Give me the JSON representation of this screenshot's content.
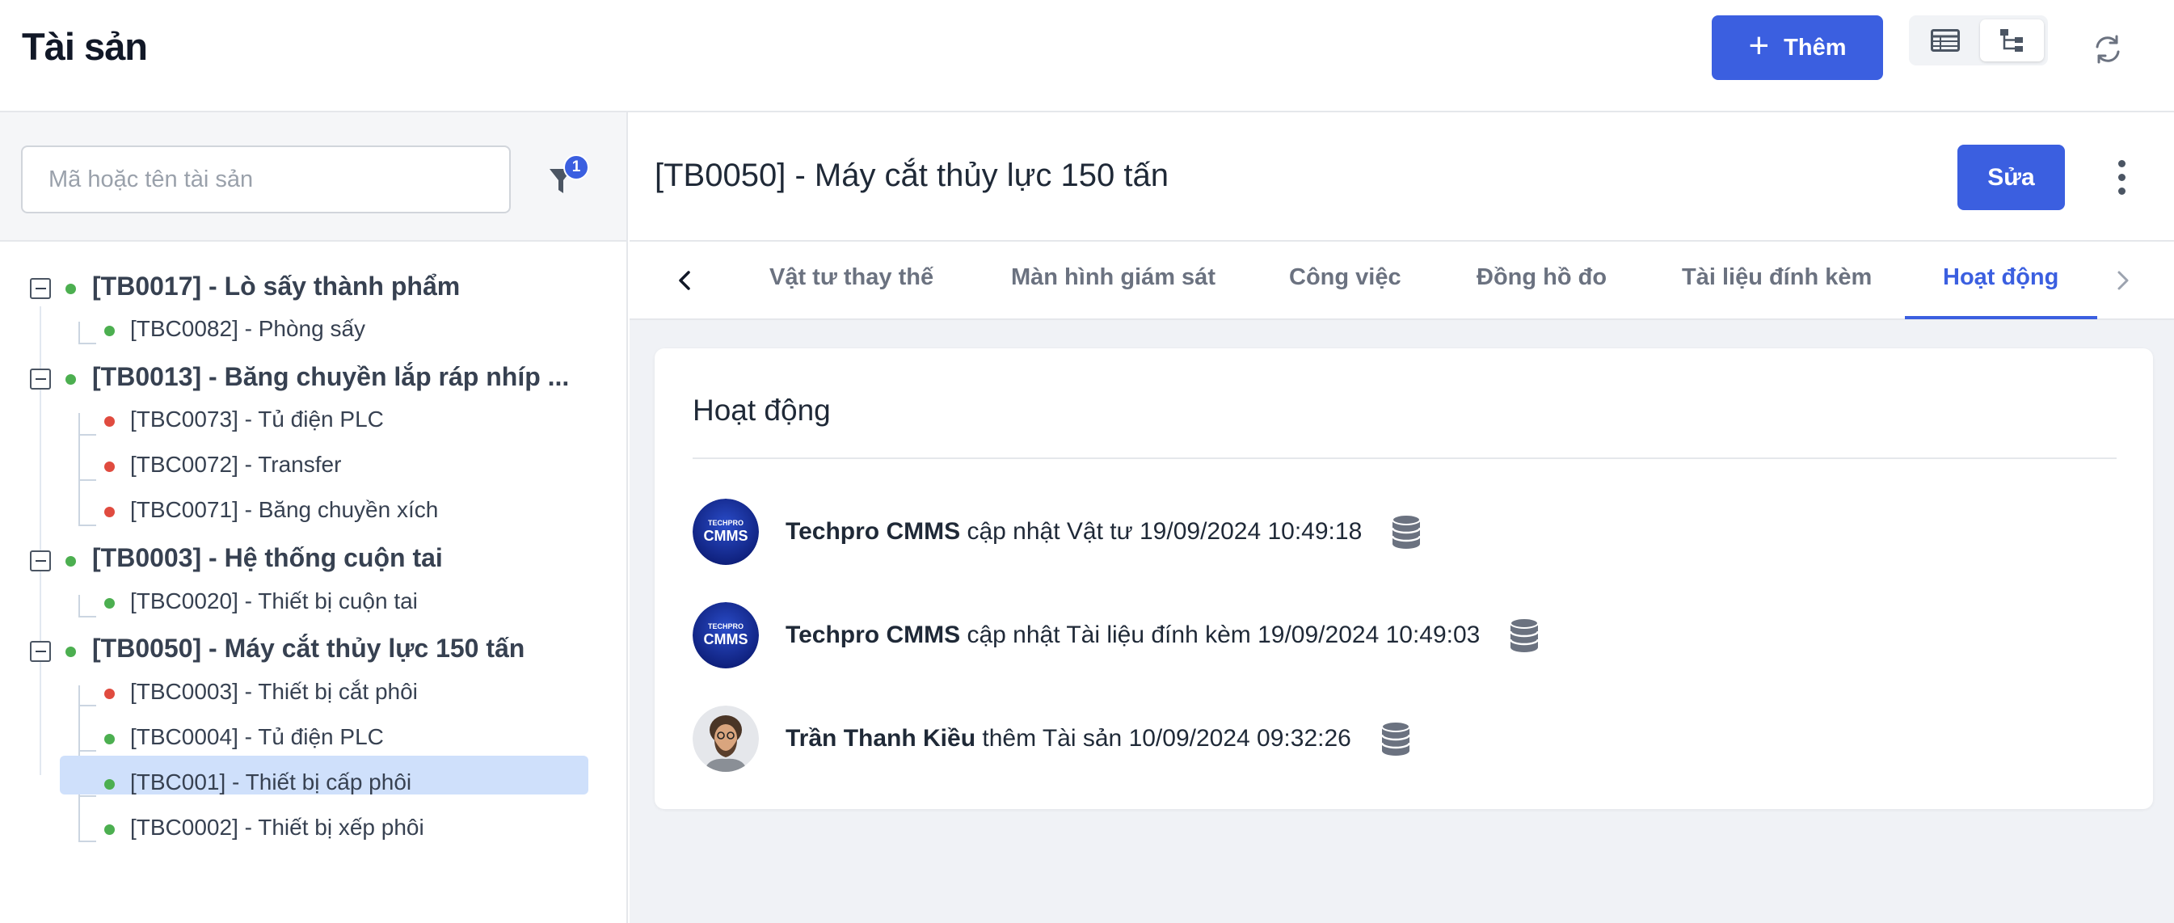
{
  "header": {
    "title": "Tài sản",
    "add_label": "Thêm"
  },
  "sidebar": {
    "search_placeholder": "Mã hoặc tên tài sản",
    "filter_count": "1",
    "tree": [
      {
        "label": "[TB0017] - Lò sấy thành phẩm",
        "status": "green",
        "children": [
          {
            "label": "[TBC0082] - Phòng sấy",
            "status": "green"
          }
        ]
      },
      {
        "label": "[TB0013] - Băng chuyền lắp ráp nhíp ...",
        "status": "green",
        "children": [
          {
            "label": "[TBC0073] - Tủ điện PLC",
            "status": "red"
          },
          {
            "label": "[TBC0072] - Transfer",
            "status": "red"
          },
          {
            "label": "[TBC0071] - Băng chuyền xích",
            "status": "red"
          }
        ]
      },
      {
        "label": "[TB0003] - Hệ thống cuộn tai",
        "status": "green",
        "children": [
          {
            "label": "[TBC0020] - Thiết bị cuộn tai",
            "status": "green"
          }
        ]
      },
      {
        "label": "[TB0050] - Máy cắt thủy lực 150 tấn",
        "status": "green",
        "selected": true,
        "children": [
          {
            "label": "[TBC0003] - Thiết bị cắt phôi",
            "status": "red"
          },
          {
            "label": "[TBC0004] - Tủ điện PLC",
            "status": "green"
          },
          {
            "label": "[TBC001] - Thiết bị cấp phôi",
            "status": "green"
          },
          {
            "label": "[TBC0002] - Thiết bị xếp phôi",
            "status": "green"
          }
        ]
      }
    ]
  },
  "detail": {
    "title": "[TB0050] - Máy cắt thủy lực 150 tấn",
    "edit_label": "Sửa",
    "tabs": [
      {
        "label": "Vật tư thay thế"
      },
      {
        "label": "Màn hình giám sát"
      },
      {
        "label": "Công việc"
      },
      {
        "label": "Đồng hồ đo"
      },
      {
        "label": "Tài liệu đính kèm"
      },
      {
        "label": "Hoạt động",
        "active": true
      }
    ],
    "activity": {
      "title": "Hoạt động",
      "items": [
        {
          "actor": "Techpro CMMS",
          "text": " cập nhật Vật tư 19/09/2024 10:49:18",
          "avatar": "techpro-logo"
        },
        {
          "actor": "Techpro CMMS",
          "text": " cập nhật Tài liệu đính kèm 19/09/2024 10:49:03",
          "avatar": "techpro-logo"
        },
        {
          "actor": "Trần Thanh Kiều",
          "text": " thêm Tài sản 10/09/2024 09:32:26",
          "avatar": "user-photo"
        }
      ],
      "logo_text_top": "TECHPRO",
      "logo_text_main": "CMMS"
    }
  },
  "colors": {
    "primary": "#3b5fe0",
    "status_green": "#4caf50",
    "status_red": "#e04b3f",
    "selected_bg": "#cfe0fb"
  }
}
